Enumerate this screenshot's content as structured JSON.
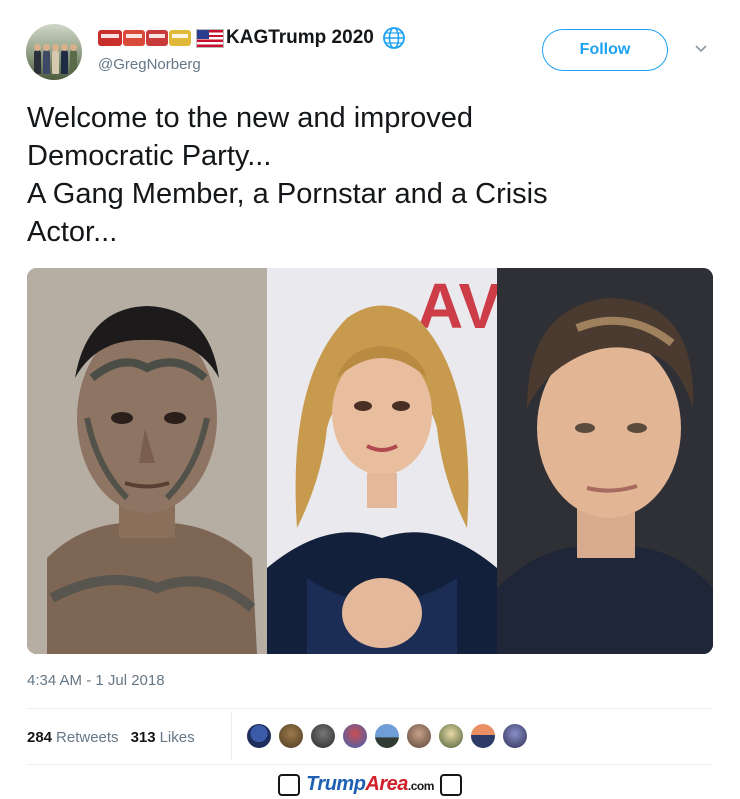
{
  "tweet": {
    "author": {
      "display_name": "KAGTrump 2020",
      "handle": "@GregNorberg"
    },
    "follow_label": "Follow",
    "text": "Welcome to the new and improved\nDemocratic Party...\nA Gang Member, a Pornstar and a Crisis\nActor...",
    "timestamp": "4:34 AM - 1 Jul 2018",
    "retweets": {
      "count": "284",
      "label": "Retweets"
    },
    "likes": {
      "count": "313",
      "label": "Likes"
    }
  },
  "colors": {
    "accent": "#1da1f2",
    "muted": "#657786",
    "text": "#14171a",
    "divider": "#e6ecf0"
  },
  "icons": {
    "name_prefix": [
      "train-emoji",
      "railway-car-emoji",
      "railway-car-emoji",
      "railway-car-emoji",
      "us-flag-emoji"
    ],
    "name_suffix": "globe-icon",
    "menu": "chevron-down-icon"
  },
  "watermark": {
    "brand_part1": "Trump",
    "brand_part2": "Area",
    "suffix": ".com"
  }
}
